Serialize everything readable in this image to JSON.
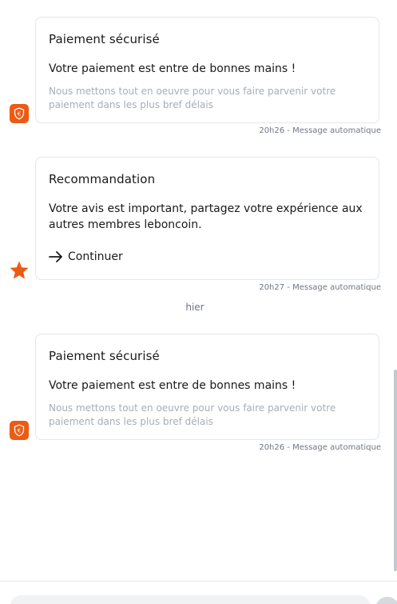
{
  "messages": [
    {
      "title": "Paiement sécurisé",
      "main": "Votre paiement est entre de bonnes mains !",
      "sub": "Nous mettons tout en oeuvre pour vous faire parvenir votre paiement dans les plus bref délais",
      "meta": "20h26 - Message automatique",
      "icon": "shield-euro-icon"
    },
    {
      "title": "Recommandation",
      "main": "Votre avis est important, partagez votre expérience aux autres membres leboncoin.",
      "cta": "Continuer",
      "meta": "20h27 - Message automatique",
      "icon": "star-icon"
    },
    {
      "title": "Paiement sécurisé",
      "main": "Votre paiement est entre de bonnes mains !",
      "sub": "Nous mettons tout en oeuvre pour vous faire parvenir votre paiement dans les plus bref délais",
      "meta": "20h26 - Message automatique",
      "icon": "shield-euro-icon"
    }
  ],
  "date_separator": "hier",
  "colors": {
    "accent": "#ec5a13",
    "muted": "#a6aeb8",
    "border": "#e3e6ea"
  }
}
